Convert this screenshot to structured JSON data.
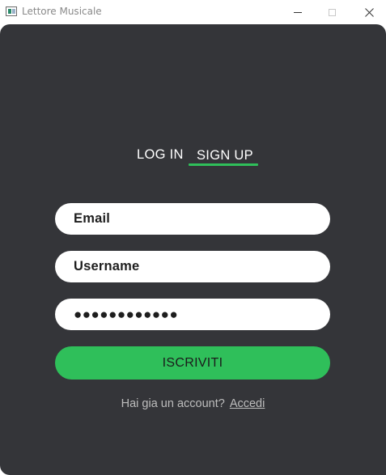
{
  "window": {
    "title": "Lettore Musicale"
  },
  "tabs": [
    {
      "label": "LOG IN",
      "active": false
    },
    {
      "label": "SIGN UP",
      "active": true
    }
  ],
  "form": {
    "email_value": "Email",
    "username_value": "Username",
    "password_value": "●●●●●●●●●●●●",
    "submit_label": "ISCRIVITI"
  },
  "footer": {
    "prompt": "Hai gia un account?",
    "link_label": "Accedi"
  },
  "colors": {
    "panel_bg": "#343539",
    "accent": "#2fbf5a",
    "field_bg": "#ffffff",
    "text_light": "#ffffff",
    "text_muted": "#bdbdbd"
  },
  "icons": {
    "app": "music-player-app-icon",
    "minimize": "minimize-icon",
    "maximize": "maximize-icon",
    "close": "close-icon"
  }
}
